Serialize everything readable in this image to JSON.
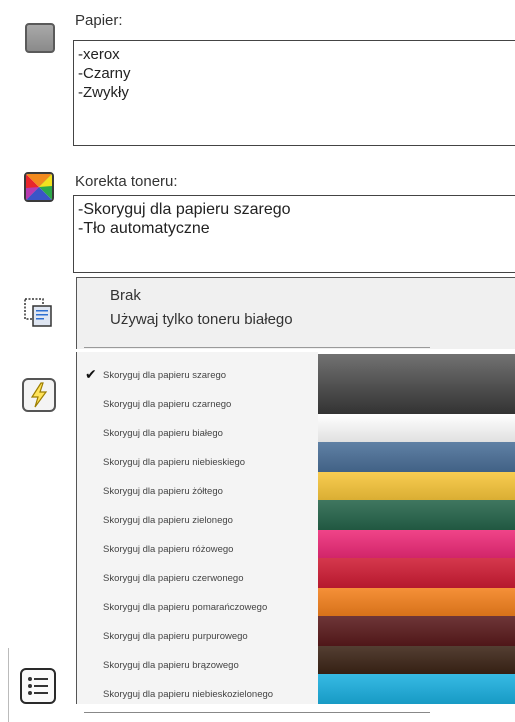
{
  "paper": {
    "label": "Papier:",
    "lines": [
      "-xerox",
      "-Czarny",
      "-Zwykły"
    ]
  },
  "toner": {
    "label": "Korekta toneru:",
    "lines": [
      "-Skoryguj dla papieru szarego",
      "-Tło automatyczne"
    ]
  },
  "dropdown": {
    "top_options": [
      "Brak",
      "Używaj tylko toneru białego"
    ],
    "selected_index": 0,
    "items": [
      {
        "label": "Skoryguj dla papieru szarego",
        "color": "#5e5e5e"
      },
      {
        "label": "Skoryguj dla papieru czarnego",
        "color": "#3a3a3a"
      },
      {
        "label": "Skoryguj dla papieru białego",
        "color": "#ffffff"
      },
      {
        "label": "Skoryguj dla papieru niebieskiego",
        "color": "#4a6f98"
      },
      {
        "label": "Skoryguj dla papieru żółtego",
        "color": "#f8c63a"
      },
      {
        "label": "Skoryguj dla papieru zielonego",
        "color": "#25644a"
      },
      {
        "label": "Skoryguj dla papieru różowego",
        "color": "#ee2a78"
      },
      {
        "label": "Skoryguj dla papieru czerwonego",
        "color": "#cf1c34"
      },
      {
        "label": "Skoryguj dla papieru pomarańczowego",
        "color": "#f4811d"
      },
      {
        "label": "Skoryguj dla papieru purpurowego",
        "color": "#5a1a1c"
      },
      {
        "label": "Skoryguj dla papieru brązowego",
        "color": "#3c2416"
      },
      {
        "label": "Skoryguj dla papieru niebieskozielonego",
        "color": "#1bb0e0"
      }
    ]
  },
  "icons": {
    "paper": "paper-gray-icon",
    "toner": "toner-color-icon",
    "copy": "copy-pages-icon",
    "flash": "lightning-icon",
    "list": "list-settings-icon"
  }
}
